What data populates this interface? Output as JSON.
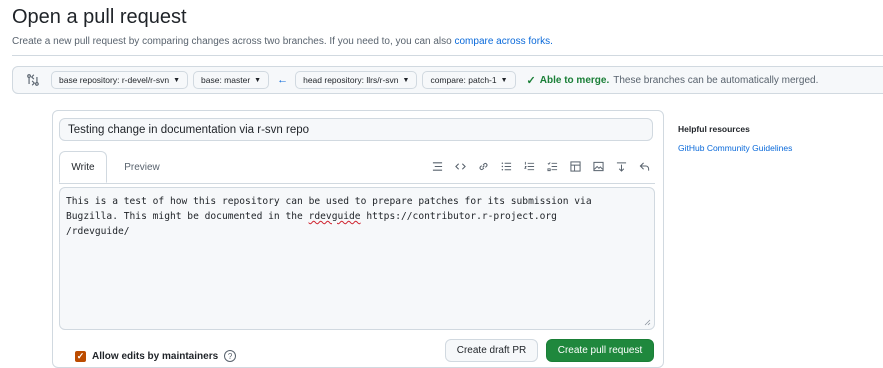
{
  "header": {
    "title": "Open a pull request",
    "subtitle": "Create a new pull request by comparing changes across two branches. If you need to, you can also ",
    "subtitle_link": "compare across forks."
  },
  "range": {
    "base_repo": "base repository: r-devel/r-svn",
    "base": "base: master",
    "head_repo": "head repository: llrs/r-svn",
    "compare": "compare: patch-1",
    "merge_status": "Able to merge.",
    "merge_message": "These branches can be automatically merged."
  },
  "composer": {
    "title_value": "Testing change in documentation via r-svn repo",
    "tabs": {
      "write": "Write",
      "preview": "Preview"
    },
    "body_before": "This is a test of how this repository can be used to prepare patches for its submission via\nBugzilla. This might be documented in the ",
    "body_misspelled": "rdevguide",
    "body_after": " https://contributor.r-project.org\n/rdevguide/"
  },
  "footer": {
    "allow_edits_label": "Allow edits by maintainers",
    "help_glyph": "?",
    "draft_button": "Create draft PR",
    "create_button": "Create pull request"
  },
  "sidebar": {
    "heading": "Helpful resources",
    "link": "GitHub Community Guidelines"
  },
  "colors": {
    "accent_link": "#0969da",
    "primary_button": "#1f883d",
    "merge_ok": "#1a7f37",
    "checkbox": "#bc4c00"
  },
  "icons": [
    "git-compare-icon",
    "heading-icon",
    "code-icon",
    "link-icon",
    "unordered-list-icon",
    "ordered-list-icon",
    "task-list-icon",
    "table-icon",
    "image-icon",
    "mention-icon",
    "reply-icon"
  ]
}
